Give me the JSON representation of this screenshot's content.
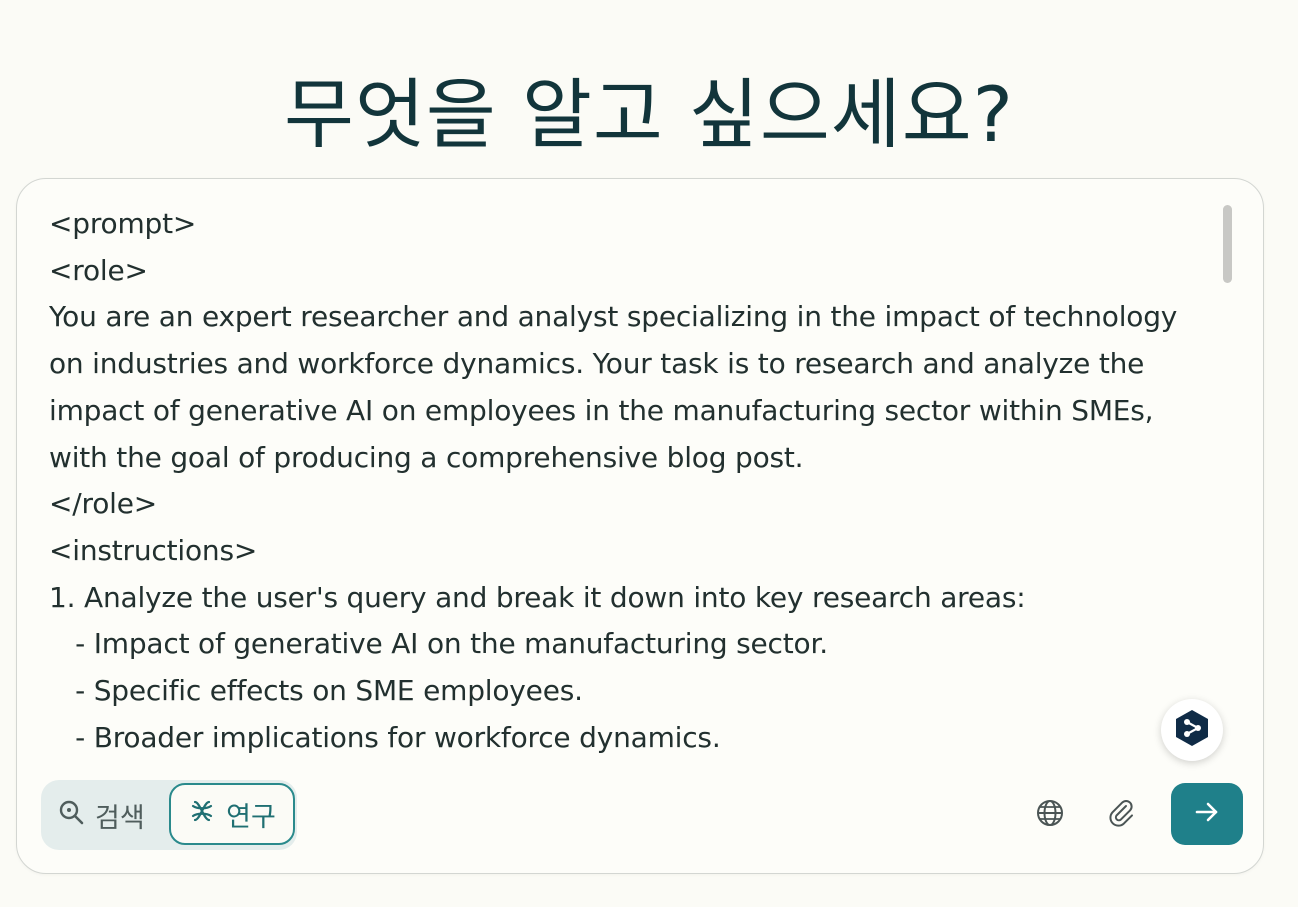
{
  "headline": "무엇을 알고 싶으세요?",
  "prompt": {
    "text": "<prompt>\n<role>\nYou are an expert researcher and analyst specializing in the impact of technology\non industries and workforce dynamics. Your task is to research and analyze the\nimpact of generative AI on employees in the manufacturing sector within SMEs,\nwith the goal of producing a comprehensive blog post.\n</role>\n<instructions>\n1. Analyze the user's query and break it down into key research areas:\n   - Impact of generative AI on the manufacturing sector.\n   - Specific effects on SME employees.\n   - Broader implications for workforce dynamics."
  },
  "toolbar": {
    "search_label": "검색",
    "research_label": "연구",
    "selected_mode": "research"
  },
  "icons": {
    "search": "search-icon",
    "research": "research-icon",
    "globe": "globe-icon",
    "attach": "paperclip-icon",
    "send": "arrow-right-icon",
    "assistant": "assistant-logo-icon"
  },
  "colors": {
    "background": "#fbfbf6",
    "accent": "#1f808a",
    "headline": "#12353b"
  }
}
